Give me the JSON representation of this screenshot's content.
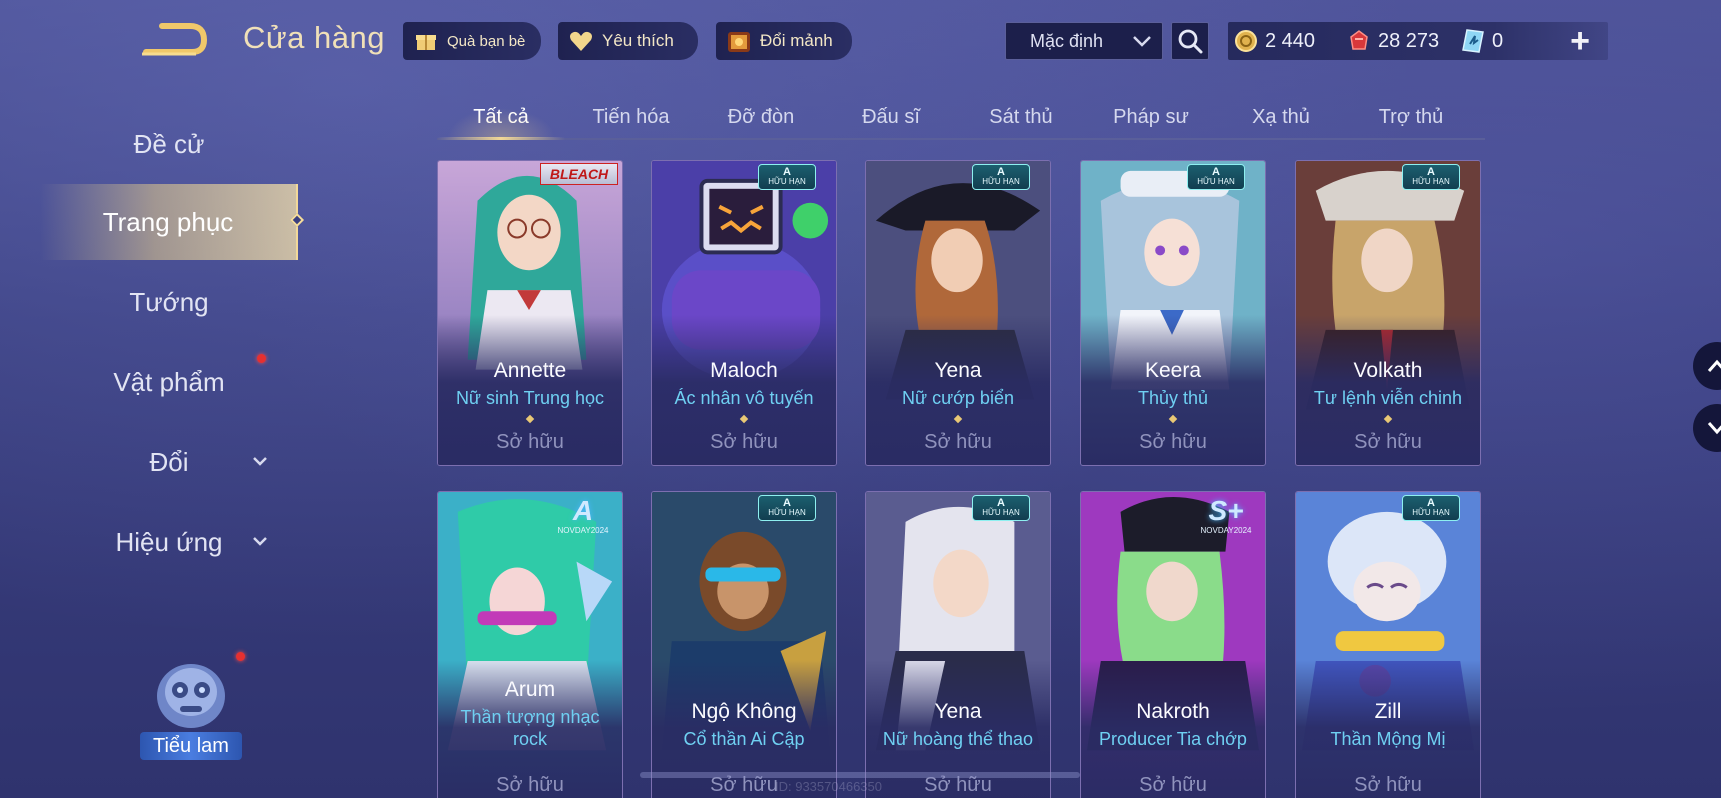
{
  "header": {
    "title": "Cửa hàng",
    "gift_label": "Quà bạn bè",
    "favorite_label": "Yêu thích",
    "exchange_label": "Đổi mảnh",
    "sort_value": "Mặc định",
    "currencies": {
      "gold": "2 440",
      "ruby": "28 273",
      "voucher": "0"
    }
  },
  "sidebar": {
    "items": [
      {
        "label": "Đề cử"
      },
      {
        "label": "Trang phục"
      },
      {
        "label": "Tướng"
      },
      {
        "label": "Vật phẩm"
      },
      {
        "label": "Đổi"
      },
      {
        "label": "Hiệu ứng"
      }
    ],
    "pet_label": "Tiểu lam"
  },
  "tabs": [
    "Tất cả",
    "Tiến hóa",
    "Đỡ đòn",
    "Đấu sĩ",
    "Sát thủ",
    "Pháp sư",
    "Xạ thủ",
    "Trợ thủ"
  ],
  "badges": {
    "grade": "A",
    "limited": "HỮU HẠN",
    "bleach": "BLEACH",
    "event_a": "A",
    "event_s": "S+",
    "event_sub": "NOVDAY2024"
  },
  "cards": [
    {
      "hero": "Annette",
      "skin": "Nữ sinh Trung học",
      "status": "Sở hữu"
    },
    {
      "hero": "Maloch",
      "skin": "Ác nhân vô tuyến",
      "status": "Sở hữu"
    },
    {
      "hero": "Yena",
      "skin": "Nữ cướp biển",
      "status": "Sở hữu"
    },
    {
      "hero": "Keera",
      "skin": "Thủy thủ",
      "status": "Sở hữu"
    },
    {
      "hero": "Volkath",
      "skin": "Tư lệnh viễn chinh",
      "status": "Sở hữu"
    },
    {
      "hero": "Arum",
      "skin": "Thần tượng nhạc rock",
      "status": "Sở hữu"
    },
    {
      "hero": "Ngộ Không",
      "skin": "Cổ thần Ai Cập",
      "status": "Sở hữu"
    },
    {
      "hero": "Yena",
      "skin": "Nữ hoàng thể thao",
      "status": "Sở hữu"
    },
    {
      "hero": "Nakroth",
      "skin": "Producer Tia chớp",
      "status": "Sở hữu"
    },
    {
      "hero": "Zill",
      "skin": "Thần Mộng Mị",
      "status": "Sở hữu"
    }
  ],
  "watermark": "ID: 933570466350"
}
